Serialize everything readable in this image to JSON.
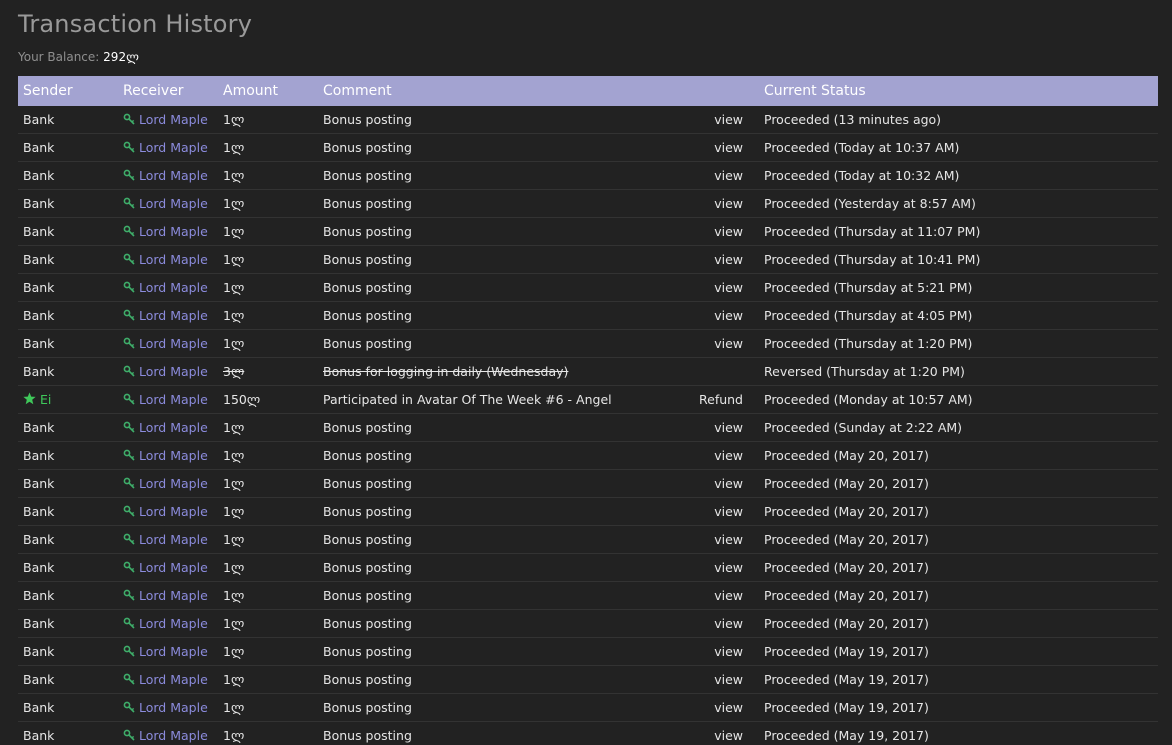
{
  "page": {
    "title": "Transaction History",
    "balance_label": "Your Balance:",
    "balance_value": "292ლ"
  },
  "table": {
    "headers": {
      "sender": "Sender",
      "receiver": "Receiver",
      "amount": "Amount",
      "comment": "Comment",
      "action": "",
      "status": "Current Status"
    },
    "rows": [
      {
        "sender": "Bank",
        "receiver": "Lord Maple",
        "amount": "1ლ",
        "comment": "Bonus posting",
        "action": "view",
        "status": "Proceeded (13 minutes ago)"
      },
      {
        "sender": "Bank",
        "receiver": "Lord Maple",
        "amount": "1ლ",
        "comment": "Bonus posting",
        "action": "view",
        "status": "Proceeded (Today at 10:37 AM)"
      },
      {
        "sender": "Bank",
        "receiver": "Lord Maple",
        "amount": "1ლ",
        "comment": "Bonus posting",
        "action": "view",
        "status": "Proceeded (Today at 10:32 AM)"
      },
      {
        "sender": "Bank",
        "receiver": "Lord Maple",
        "amount": "1ლ",
        "comment": "Bonus posting",
        "action": "view",
        "status": "Proceeded (Yesterday at 8:57 AM)"
      },
      {
        "sender": "Bank",
        "receiver": "Lord Maple",
        "amount": "1ლ",
        "comment": "Bonus posting",
        "action": "view",
        "status": "Proceeded (Thursday at 11:07 PM)"
      },
      {
        "sender": "Bank",
        "receiver": "Lord Maple",
        "amount": "1ლ",
        "comment": "Bonus posting",
        "action": "view",
        "status": "Proceeded (Thursday at 10:41 PM)"
      },
      {
        "sender": "Bank",
        "receiver": "Lord Maple",
        "amount": "1ლ",
        "comment": "Bonus posting",
        "action": "view",
        "status": "Proceeded (Thursday at 5:21 PM)"
      },
      {
        "sender": "Bank",
        "receiver": "Lord Maple",
        "amount": "1ლ",
        "comment": "Bonus posting",
        "action": "view",
        "status": "Proceeded (Thursday at 4:05 PM)"
      },
      {
        "sender": "Bank",
        "receiver": "Lord Maple",
        "amount": "1ლ",
        "comment": "Bonus posting",
        "action": "view",
        "status": "Proceeded (Thursday at 1:20 PM)"
      },
      {
        "sender": "Bank",
        "receiver": "Lord Maple",
        "amount": "3ლ",
        "comment": "Bonus for logging in daily (Wednesday)",
        "action": "",
        "status": "Reversed (Thursday at 1:20 PM)",
        "struck": true
      },
      {
        "sender": "Ei",
        "sender_special": true,
        "receiver": "Lord Maple",
        "amount": "150ლ",
        "comment": "Participated in Avatar Of The Week #6 - Angel",
        "action": "Refund",
        "status": "Proceeded (Monday at 10:57 AM)"
      },
      {
        "sender": "Bank",
        "receiver": "Lord Maple",
        "amount": "1ლ",
        "comment": "Bonus posting",
        "action": "view",
        "status": "Proceeded (Sunday at 2:22 AM)"
      },
      {
        "sender": "Bank",
        "receiver": "Lord Maple",
        "amount": "1ლ",
        "comment": "Bonus posting",
        "action": "view",
        "status": "Proceeded (May 20, 2017)"
      },
      {
        "sender": "Bank",
        "receiver": "Lord Maple",
        "amount": "1ლ",
        "comment": "Bonus posting",
        "action": "view",
        "status": "Proceeded (May 20, 2017)"
      },
      {
        "sender": "Bank",
        "receiver": "Lord Maple",
        "amount": "1ლ",
        "comment": "Bonus posting",
        "action": "view",
        "status": "Proceeded (May 20, 2017)"
      },
      {
        "sender": "Bank",
        "receiver": "Lord Maple",
        "amount": "1ლ",
        "comment": "Bonus posting",
        "action": "view",
        "status": "Proceeded (May 20, 2017)"
      },
      {
        "sender": "Bank",
        "receiver": "Lord Maple",
        "amount": "1ლ",
        "comment": "Bonus posting",
        "action": "view",
        "status": "Proceeded (May 20, 2017)"
      },
      {
        "sender": "Bank",
        "receiver": "Lord Maple",
        "amount": "1ლ",
        "comment": "Bonus posting",
        "action": "view",
        "status": "Proceeded (May 20, 2017)"
      },
      {
        "sender": "Bank",
        "receiver": "Lord Maple",
        "amount": "1ლ",
        "comment": "Bonus posting",
        "action": "view",
        "status": "Proceeded (May 20, 2017)"
      },
      {
        "sender": "Bank",
        "receiver": "Lord Maple",
        "amount": "1ლ",
        "comment": "Bonus posting",
        "action": "view",
        "status": "Proceeded (May 19, 2017)"
      },
      {
        "sender": "Bank",
        "receiver": "Lord Maple",
        "amount": "1ლ",
        "comment": "Bonus posting",
        "action": "view",
        "status": "Proceeded (May 19, 2017)"
      },
      {
        "sender": "Bank",
        "receiver": "Lord Maple",
        "amount": "1ლ",
        "comment": "Bonus posting",
        "action": "view",
        "status": "Proceeded (May 19, 2017)"
      },
      {
        "sender": "Bank",
        "receiver": "Lord Maple",
        "amount": "1ლ",
        "comment": "Bonus posting",
        "action": "view",
        "status": "Proceeded (May 19, 2017)"
      }
    ]
  },
  "icons": {
    "receiver": "key-icon",
    "special_sender": "star-icon"
  },
  "colors": {
    "background": "#222222",
    "header_bg": "#a3a3d1",
    "link": "#8b8bdc",
    "key_icon": "#3fae6a",
    "star_icon": "#3fc85a"
  }
}
